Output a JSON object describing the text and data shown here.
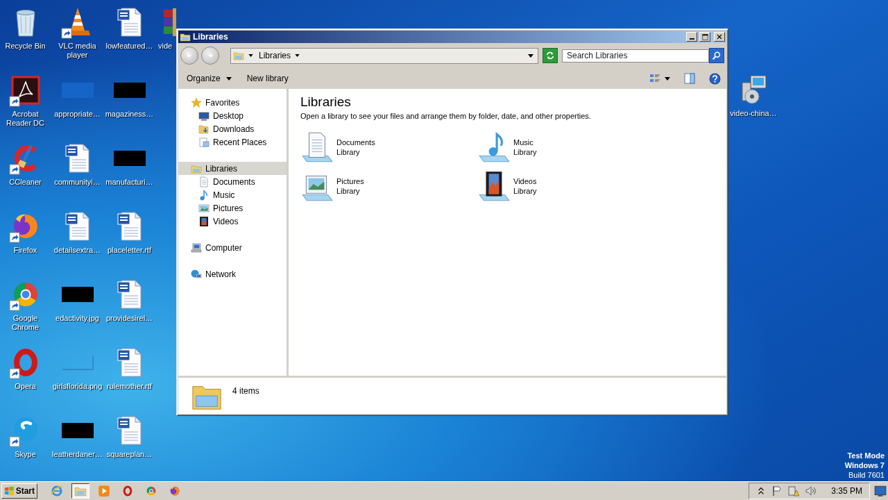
{
  "desktop": {
    "columns": [
      [
        {
          "label": "Recycle Bin",
          "kind": "recycle-bin",
          "shortcut": false
        },
        {
          "label": "Acrobat\nReader DC",
          "kind": "acrobat",
          "shortcut": true
        },
        {
          "label": "CCleaner",
          "kind": "ccleaner",
          "shortcut": true
        },
        {
          "label": "Firefox",
          "kind": "firefox",
          "shortcut": true
        },
        {
          "label": "Google\nChrome",
          "kind": "chrome",
          "shortcut": true
        },
        {
          "label": "Opera",
          "kind": "opera",
          "shortcut": true
        },
        {
          "label": "Skype",
          "kind": "skype",
          "shortcut": true
        }
      ],
      [
        {
          "label": "VLC media\nplayer",
          "kind": "vlc",
          "shortcut": true
        },
        {
          "label": "appropriate…",
          "kind": "thumb-blue"
        },
        {
          "label": "communityi…",
          "kind": "word",
          "shortcut": false
        },
        {
          "label": "detailsextra…",
          "kind": "word",
          "shortcut": false
        },
        {
          "label": "edactivity.jpg",
          "kind": "thumb-dark"
        },
        {
          "label": "girlsflorida.png",
          "kind": "thumb-empty"
        },
        {
          "label": "leatherdaner…",
          "kind": "thumb-dark"
        }
      ],
      [
        {
          "label": "lowfeatured…",
          "kind": "word",
          "shortcut": false
        },
        {
          "label": "magaziness…",
          "kind": "thumb-dark"
        },
        {
          "label": "manufacturi…",
          "kind": "thumb-dark"
        },
        {
          "label": "placeletter.rtf",
          "kind": "word",
          "shortcut": false
        },
        {
          "label": "providesirel…",
          "kind": "word",
          "shortcut": false
        },
        {
          "label": "rulemother.rtf",
          "kind": "word",
          "shortcut": false
        },
        {
          "label": "squareplan…",
          "kind": "word",
          "shortcut": false
        }
      ],
      [
        {
          "label": "vide",
          "kind": "winrar",
          "shortcut": false
        }
      ]
    ],
    "right_icons": [
      {
        "label": "video-china…",
        "kind": "installer",
        "shortcut": false
      }
    ],
    "watermark": [
      "Test Mode",
      "Windows 7",
      "Build 7601"
    ]
  },
  "window": {
    "title": "Libraries",
    "breadcrumb": "Libraries",
    "search": {
      "placeholder": "Search Libraries"
    },
    "toolbar": [
      {
        "label": "Organize",
        "dropdown": true
      },
      {
        "label": "New library",
        "dropdown": false
      }
    ],
    "nav_tree": [
      {
        "label": "Favorites",
        "kind": "star",
        "selected": false,
        "children": [
          {
            "label": "Desktop",
            "kind": "desktop",
            "selected": false
          },
          {
            "label": "Downloads",
            "kind": "downloads",
            "selected": false
          },
          {
            "label": "Recent Places",
            "kind": "recent",
            "selected": false
          }
        ]
      },
      {
        "label": "Libraries",
        "kind": "libraries",
        "selected": true,
        "children": [
          {
            "label": "Documents",
            "kind": "documents",
            "selected": false
          },
          {
            "label": "Music",
            "kind": "music",
            "selected": false
          },
          {
            "label": "Pictures",
            "kind": "pictures",
            "selected": false
          },
          {
            "label": "Videos",
            "kind": "videos",
            "selected": false
          }
        ]
      },
      {
        "label": "Computer",
        "kind": "computer",
        "selected": false
      },
      {
        "label": "Network",
        "kind": "network",
        "selected": false
      }
    ],
    "heading": "Libraries",
    "description": "Open a library to see your files and arrange them by folder, date, and other properties.",
    "items": [
      {
        "name": "Documents",
        "type": "Library",
        "kind": "lib-documents"
      },
      {
        "name": "Music",
        "type": "Library",
        "kind": "lib-music"
      },
      {
        "name": "Pictures",
        "type": "Library",
        "kind": "lib-pictures"
      },
      {
        "name": "Videos",
        "type": "Library",
        "kind": "lib-videos"
      }
    ],
    "status": "4 items"
  },
  "taskbar": {
    "start": "Start",
    "apps": [
      {
        "kind": "ie",
        "selected": false
      },
      {
        "kind": "explorer",
        "selected": true
      },
      {
        "kind": "media-player",
        "selected": false
      },
      {
        "kind": "opera",
        "selected": false
      },
      {
        "kind": "chrome",
        "selected": false
      },
      {
        "kind": "firefox",
        "selected": false
      }
    ],
    "clock": "3:35 PM"
  }
}
